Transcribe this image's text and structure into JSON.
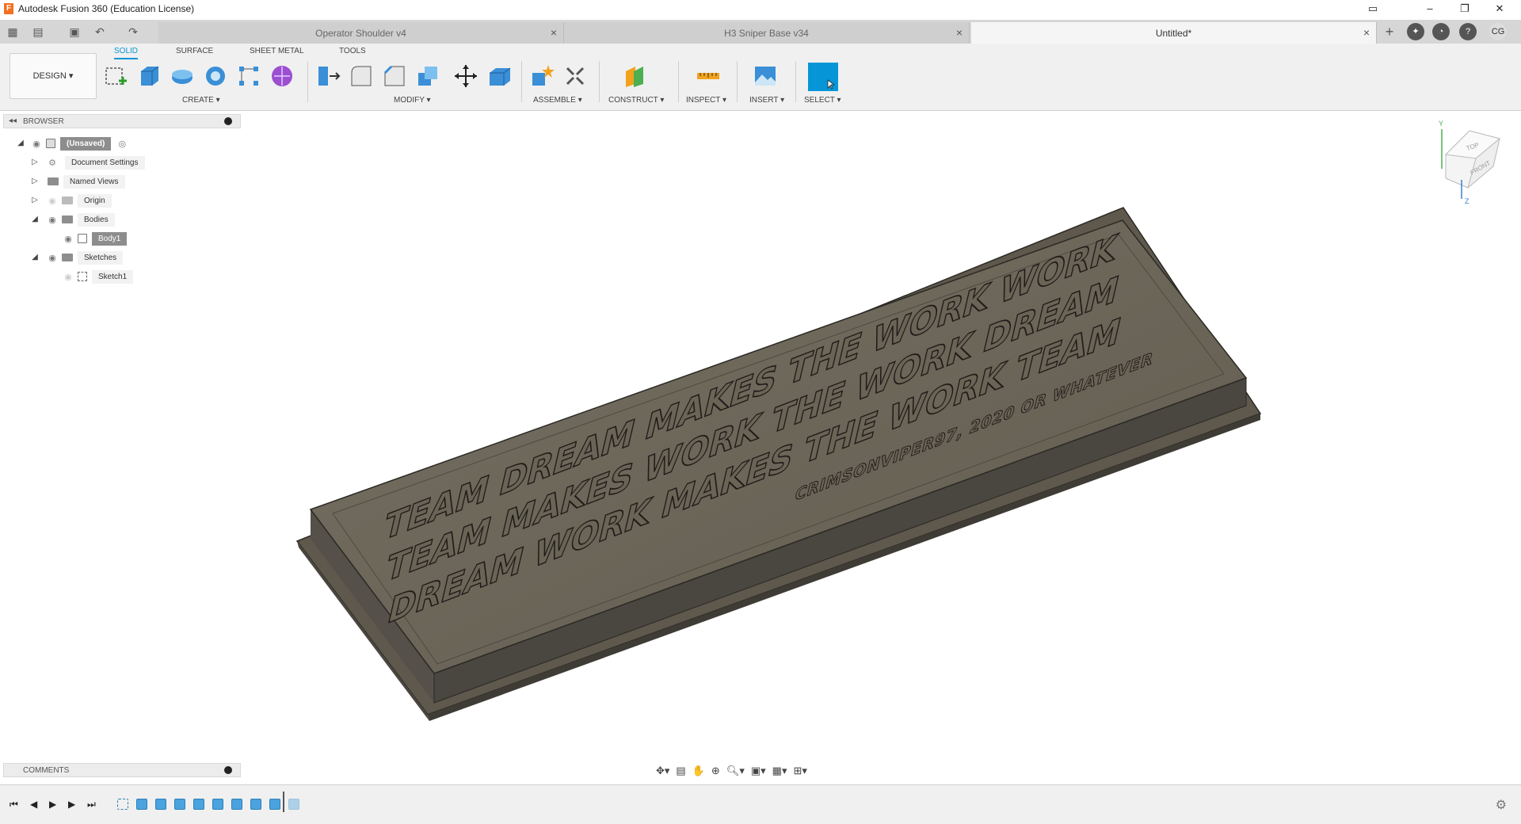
{
  "window": {
    "title": "Autodesk Fusion 360 (Education License)",
    "controls": {
      "minimize": "–",
      "restore": "❐",
      "close": "✕"
    }
  },
  "tabs": [
    {
      "name": "Operator Shoulder v4",
      "active": false
    },
    {
      "name": "H3 Sniper Base v34",
      "active": false
    },
    {
      "name": "Untitled*",
      "active": true
    }
  ],
  "user": {
    "initials": "CG"
  },
  "ribbon": {
    "workspace": "DESIGN ▾",
    "tabs": [
      "SOLID",
      "SURFACE",
      "SHEET METAL",
      "TOOLS"
    ],
    "active_tab": "SOLID",
    "groups": [
      "CREATE ▾",
      "MODIFY ▾",
      "ASSEMBLE ▾",
      "CONSTRUCT ▾",
      "INSPECT ▾",
      "INSERT ▾",
      "SELECT ▾"
    ]
  },
  "browser": {
    "title": "BROWSER",
    "root": "(Unsaved)",
    "items": [
      "Document Settings",
      "Named Views",
      "Origin",
      "Bodies",
      "Body1",
      "Sketches",
      "Sketch1"
    ]
  },
  "comments": {
    "title": "COMMENTS"
  },
  "viewcube": {
    "top": "TOP",
    "front": "FRONT",
    "axis_y": "Y",
    "axis_z": "Z"
  },
  "model_text": {
    "line1": "TEAM DREAM MAKES THE WORK WORK",
    "line2": "TEAM MAKES WORK THE WORK DREAM",
    "line3": "DREAM WORK MAKES THE WORK TEAM",
    "credit": "CRIMSONVIPER97, 2020 OR WHATEVER"
  },
  "colors": {
    "accent": "#0696d7",
    "plate_top": "#6c6558",
    "plate_side": "#4e4a42",
    "text_fill": "#5a5448"
  }
}
